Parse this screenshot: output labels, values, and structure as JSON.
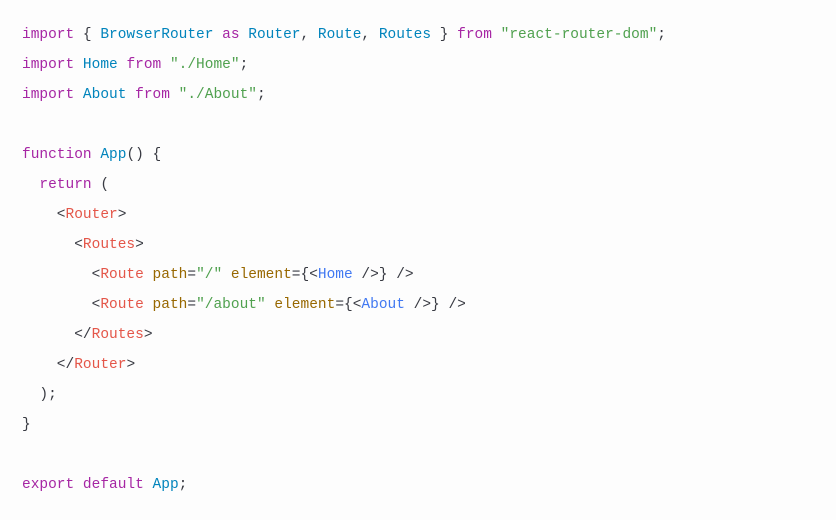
{
  "code": {
    "lines": [
      [
        {
          "t": "import",
          "c": "kw"
        },
        {
          "t": " { "
        },
        {
          "t": "BrowserRouter",
          "c": "type"
        },
        {
          "t": " "
        },
        {
          "t": "as",
          "c": "kw"
        },
        {
          "t": " "
        },
        {
          "t": "Router",
          "c": "type"
        },
        {
          "t": ", "
        },
        {
          "t": "Route",
          "c": "type"
        },
        {
          "t": ", "
        },
        {
          "t": "Routes",
          "c": "type"
        },
        {
          "t": " } "
        },
        {
          "t": "from",
          "c": "kw"
        },
        {
          "t": " "
        },
        {
          "t": "\"react-router-dom\"",
          "c": "str"
        },
        {
          "t": ";"
        }
      ],
      [
        {
          "t": "import",
          "c": "kw"
        },
        {
          "t": " "
        },
        {
          "t": "Home",
          "c": "type"
        },
        {
          "t": " "
        },
        {
          "t": "from",
          "c": "kw"
        },
        {
          "t": " "
        },
        {
          "t": "\"./Home\"",
          "c": "str"
        },
        {
          "t": ";"
        }
      ],
      [
        {
          "t": "import",
          "c": "kw"
        },
        {
          "t": " "
        },
        {
          "t": "About",
          "c": "type"
        },
        {
          "t": " "
        },
        {
          "t": "from",
          "c": "kw"
        },
        {
          "t": " "
        },
        {
          "t": "\"./About\"",
          "c": "str"
        },
        {
          "t": ";"
        }
      ],
      [
        {
          "t": " "
        }
      ],
      [
        {
          "t": "function",
          "c": "kw"
        },
        {
          "t": " "
        },
        {
          "t": "App",
          "c": "type"
        },
        {
          "t": "() {"
        }
      ],
      [
        {
          "t": "  "
        },
        {
          "t": "return",
          "c": "kw"
        },
        {
          "t": " ("
        }
      ],
      [
        {
          "t": "    <"
        },
        {
          "t": "Router",
          "c": "tag"
        },
        {
          "t": ">"
        }
      ],
      [
        {
          "t": "      <"
        },
        {
          "t": "Routes",
          "c": "tag"
        },
        {
          "t": ">"
        }
      ],
      [
        {
          "t": "        <"
        },
        {
          "t": "Route",
          "c": "tag"
        },
        {
          "t": " "
        },
        {
          "t": "path",
          "c": "attr"
        },
        {
          "t": "="
        },
        {
          "t": "\"/\"",
          "c": "str"
        },
        {
          "t": " "
        },
        {
          "t": "element",
          "c": "attr"
        },
        {
          "t": "={<"
        },
        {
          "t": "Home",
          "c": "jsxc"
        },
        {
          "t": " />} />"
        }
      ],
      [
        {
          "t": "        <"
        },
        {
          "t": "Route",
          "c": "tag"
        },
        {
          "t": " "
        },
        {
          "t": "path",
          "c": "attr"
        },
        {
          "t": "="
        },
        {
          "t": "\"/about\"",
          "c": "str"
        },
        {
          "t": " "
        },
        {
          "t": "element",
          "c": "attr"
        },
        {
          "t": "={<"
        },
        {
          "t": "About",
          "c": "jsxc"
        },
        {
          "t": " />} />"
        }
      ],
      [
        {
          "t": "      </"
        },
        {
          "t": "Routes",
          "c": "tag"
        },
        {
          "t": ">"
        }
      ],
      [
        {
          "t": "    </"
        },
        {
          "t": "Router",
          "c": "tag"
        },
        {
          "t": ">"
        }
      ],
      [
        {
          "t": "  );"
        }
      ],
      [
        {
          "t": "}"
        }
      ],
      [
        {
          "t": " "
        }
      ],
      [
        {
          "t": "export",
          "c": "kw"
        },
        {
          "t": " "
        },
        {
          "t": "default",
          "c": "kw"
        },
        {
          "t": " "
        },
        {
          "t": "App",
          "c": "type"
        },
        {
          "t": ";"
        }
      ]
    ]
  }
}
